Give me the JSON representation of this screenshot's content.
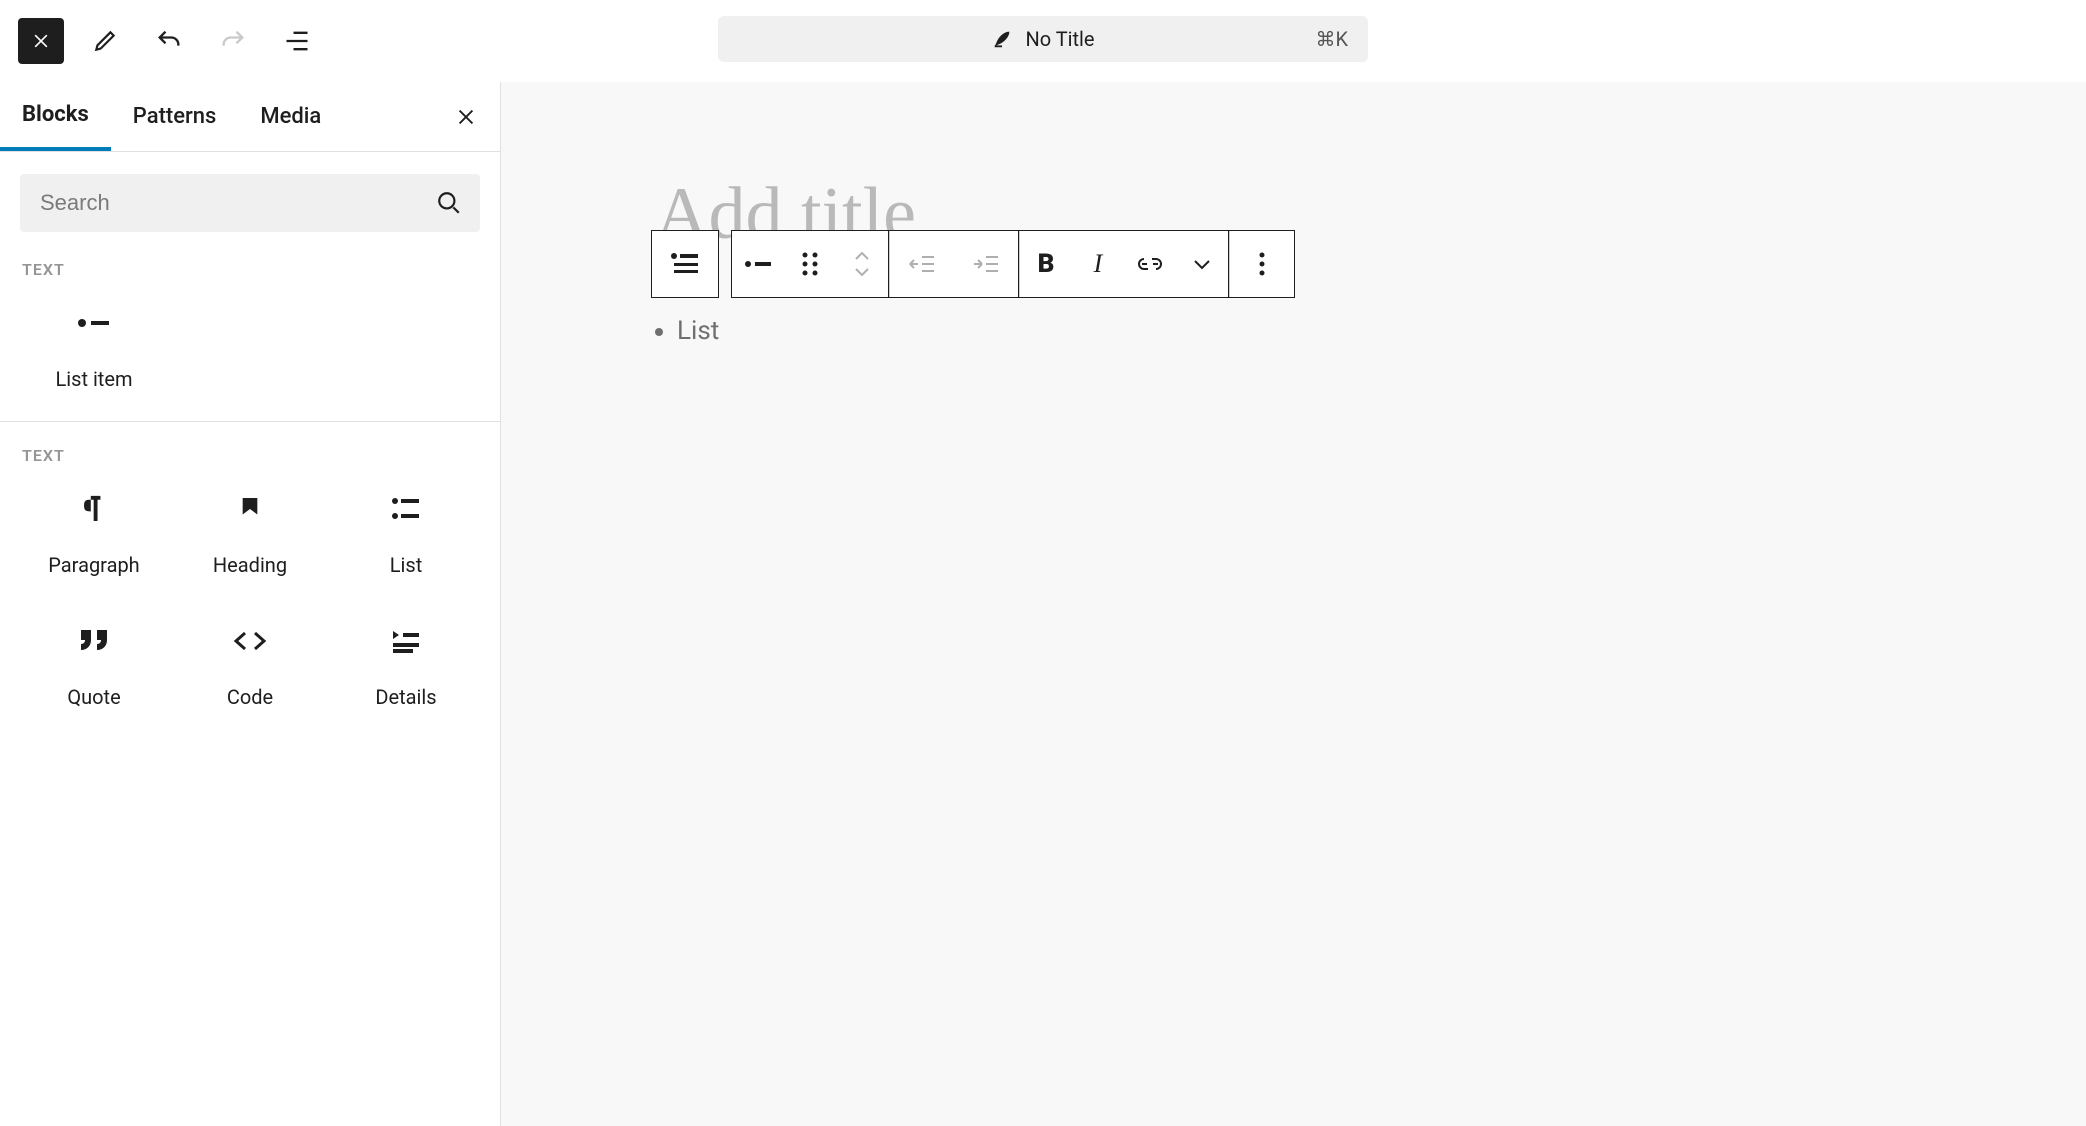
{
  "topbar": {
    "doc_title": "No Title",
    "shortcut": "⌘K"
  },
  "sidebar": {
    "tabs": [
      "Blocks",
      "Patterns",
      "Media"
    ],
    "active_tab": 0,
    "search_placeholder": "Search",
    "section1_heading": "TEXT",
    "section1_items": [
      {
        "label": "List item",
        "icon": "list-item"
      }
    ],
    "section2_heading": "TEXT",
    "section2_items": [
      {
        "label": "Paragraph",
        "icon": "paragraph"
      },
      {
        "label": "Heading",
        "icon": "heading"
      },
      {
        "label": "List",
        "icon": "list"
      },
      {
        "label": "Quote",
        "icon": "quote"
      },
      {
        "label": "Code",
        "icon": "code"
      },
      {
        "label": "Details",
        "icon": "details"
      }
    ]
  },
  "editor": {
    "title_placeholder": "Add title",
    "list_placeholder": "List"
  }
}
